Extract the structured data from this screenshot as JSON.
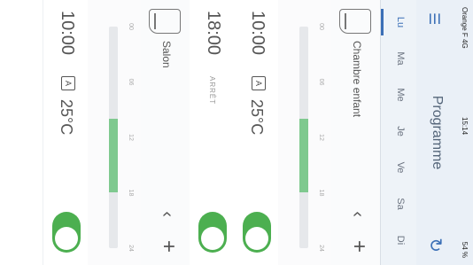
{
  "status_bar": {
    "carrier": "Orange F 4G",
    "time": "15:14",
    "battery": "54 %"
  },
  "header": {
    "title": "Programme"
  },
  "days": [
    {
      "label": "Lu",
      "selected": true
    },
    {
      "label": "Ma",
      "selected": false
    },
    {
      "label": "Me",
      "selected": false
    },
    {
      "label": "Je",
      "selected": false
    },
    {
      "label": "Ve",
      "selected": false
    },
    {
      "label": "Sa",
      "selected": false
    },
    {
      "label": "Di",
      "selected": false
    }
  ],
  "axis_ticks": [
    "00",
    "06",
    "12",
    "18",
    "24"
  ],
  "rooms": [
    {
      "name": "Chambre enfant",
      "active_range_hours": [
        10,
        18
      ],
      "slots": [
        {
          "time": "10:00",
          "mode": "A",
          "temp": "25°C",
          "enabled": true
        },
        {
          "time": "18:00",
          "status": "ARRÊT",
          "enabled": true
        }
      ]
    },
    {
      "name": "Salon",
      "active_range_hours": [
        10,
        18
      ],
      "slots": [
        {
          "time": "10:00",
          "mode": "A",
          "temp": "25°C",
          "enabled": true
        }
      ]
    }
  ],
  "colors": {
    "accent": "#3b6fb6",
    "active": "#4caf50",
    "range": "#7fc98f"
  }
}
